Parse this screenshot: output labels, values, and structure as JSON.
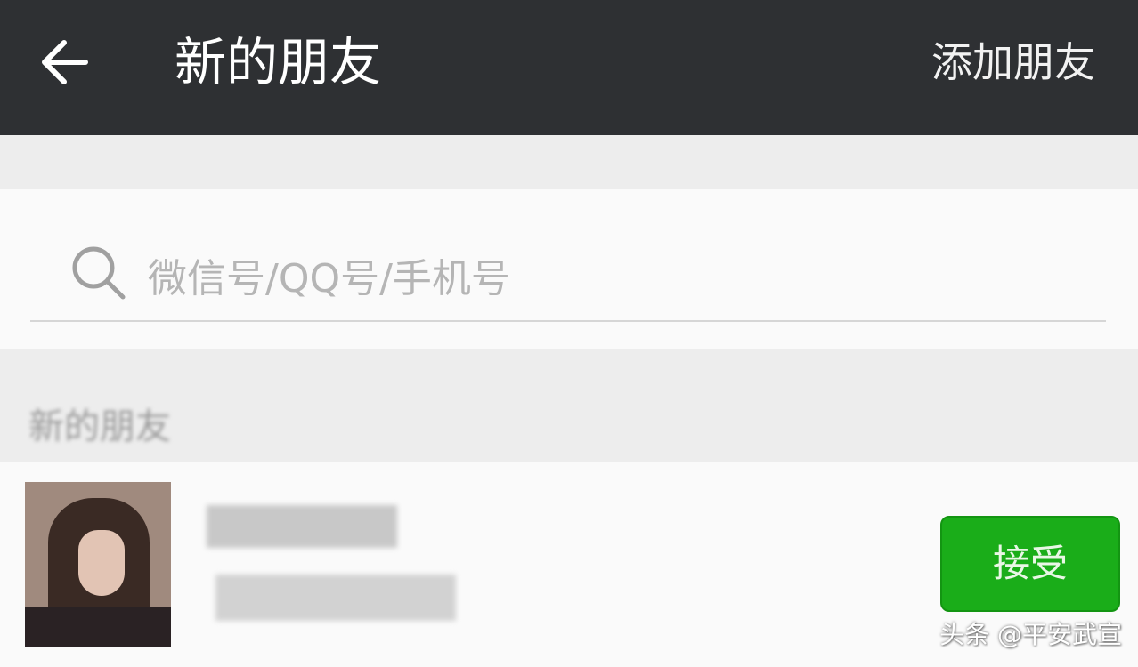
{
  "header": {
    "title": "新的朋友",
    "add_friend_label": "添加朋友",
    "back_icon": "arrow-left-icon"
  },
  "search": {
    "placeholder": "微信号/QQ号/手机号",
    "value": "",
    "icon": "search-icon"
  },
  "section": {
    "label": "新的朋友"
  },
  "request": {
    "accept_label": "接受"
  },
  "watermark": {
    "text": "头条 @平安武宣"
  },
  "colors": {
    "header_bg": "#2e3033",
    "page_bg": "#ededed",
    "accept_green": "#1aad19"
  }
}
